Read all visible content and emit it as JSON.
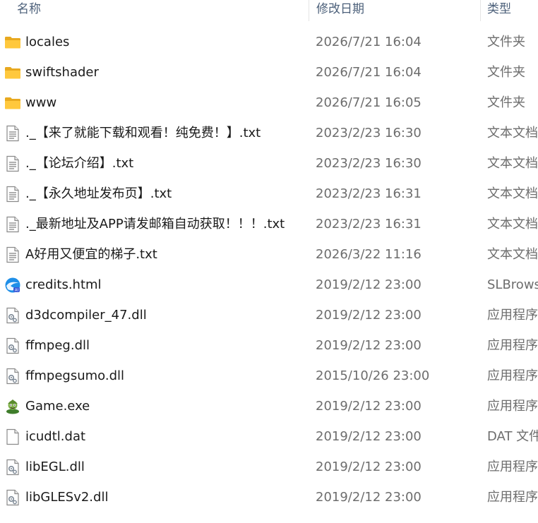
{
  "header": {
    "name_label": "名称",
    "date_label": "修改日期",
    "type_label": "类型"
  },
  "files": [
    {
      "name": "locales",
      "date": "2026/7/21 16:04",
      "type": "文件夹",
      "icon": "folder-icon"
    },
    {
      "name": "swiftshader",
      "date": "2026/7/21 16:04",
      "type": "文件夹",
      "icon": "folder-icon"
    },
    {
      "name": "www",
      "date": "2026/7/21 16:05",
      "type": "文件夹",
      "icon": "folder-icon"
    },
    {
      "name": "._【来了就能下载和观看！纯免费！】.txt",
      "date": "2023/2/23 16:30",
      "type": "文本文档",
      "icon": "text-file-icon"
    },
    {
      "name": "._【论坛介绍】.txt",
      "date": "2023/2/23 16:30",
      "type": "文本文档",
      "icon": "text-file-icon"
    },
    {
      "name": "._【永久地址发布页】.txt",
      "date": "2023/2/23 16:31",
      "type": "文本文档",
      "icon": "text-file-icon"
    },
    {
      "name": "._最新地址及APP请发邮箱自动获取！！！.txt",
      "date": "2023/2/23 16:31",
      "type": "文本文档",
      "icon": "text-file-icon"
    },
    {
      "name": "A好用又便宜的梯子.txt",
      "date": "2026/3/22 11:16",
      "type": "文本文档",
      "icon": "text-file-icon"
    },
    {
      "name": "credits.html",
      "date": "2019/2/12 23:00",
      "type": "SLBrowser",
      "icon": "browser-icon"
    },
    {
      "name": "d3dcompiler_47.dll",
      "date": "2019/2/12 23:00",
      "type": "应用程序扩展",
      "icon": "dll-file-icon"
    },
    {
      "name": "ffmpeg.dll",
      "date": "2019/2/12 23:00",
      "type": "应用程序扩展",
      "icon": "dll-file-icon"
    },
    {
      "name": "ffmpegsumo.dll",
      "date": "2015/10/26 23:00",
      "type": "应用程序扩展",
      "icon": "dll-file-icon"
    },
    {
      "name": "Game.exe",
      "date": "2019/2/12 23:00",
      "type": "应用程序",
      "icon": "game-exe-icon"
    },
    {
      "name": "icudtl.dat",
      "date": "2019/2/12 23:00",
      "type": "DAT 文件",
      "icon": "blank-file-icon"
    },
    {
      "name": "libEGL.dll",
      "date": "2019/2/12 23:00",
      "type": "应用程序扩展",
      "icon": "dll-file-icon"
    },
    {
      "name": "libGLESv2.dll",
      "date": "2019/2/12 23:00",
      "type": "应用程序扩展",
      "icon": "dll-file-icon"
    }
  ]
}
